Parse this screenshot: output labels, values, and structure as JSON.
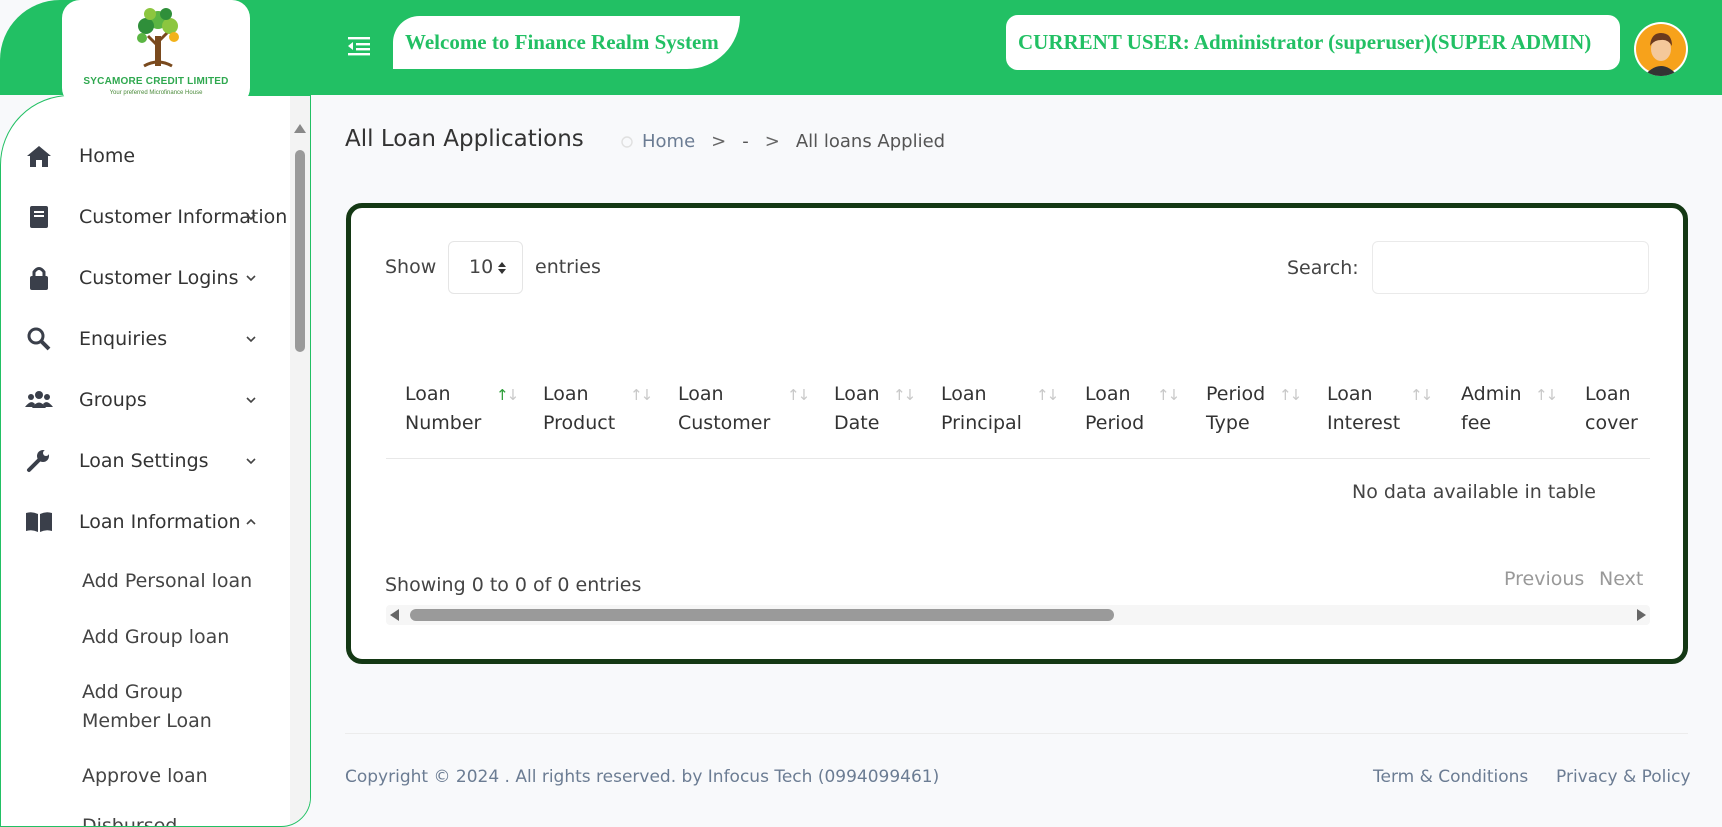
{
  "colors": {
    "brand_green": "#22c064",
    "card_border": "#143814",
    "muted_text": "#6b7c93"
  },
  "header": {
    "logo_title": "SYCAMORE CREDIT LIMITED",
    "logo_tagline": "Your preferred Microfinance House",
    "welcome": "Welcome to Finance Realm System",
    "current_user": "CURRENT USER: Administrator (superuser)(SUPER ADMIN)",
    "menu_icon": "menu-toggle-icon",
    "avatar_icon": "user-avatar"
  },
  "sidebar": {
    "items": [
      {
        "label": "Home",
        "icon": "home-icon"
      },
      {
        "label": "Customer Information",
        "icon": "book-icon",
        "expanded": false
      },
      {
        "label": "Customer Logins",
        "icon": "lock-icon",
        "expanded": false
      },
      {
        "label": "Enquiries",
        "icon": "search-icon",
        "expanded": false
      },
      {
        "label": "Groups",
        "icon": "users-icon",
        "expanded": false
      },
      {
        "label": "Loan Settings",
        "icon": "wrench-icon",
        "expanded": false
      },
      {
        "label": "Loan Information",
        "icon": "open-book-icon",
        "expanded": true
      }
    ],
    "sub_items": [
      "Add Personal loan",
      "Add Group loan",
      "Add Group\nMember Loan",
      "Approve loan",
      "Disbursed"
    ]
  },
  "page": {
    "title": "All Loan Applications",
    "breadcrumb": {
      "home": "Home",
      "sep": ">",
      "middle": "-",
      "current": "All loans Applied"
    }
  },
  "table": {
    "show_label": "Show",
    "page_size": "10",
    "entries_label": "entries",
    "search_label": "Search:",
    "search_value": "",
    "columns": [
      {
        "line1": "Loan",
        "line2": "Number",
        "sort": "asc"
      },
      {
        "line1": "Loan",
        "line2": "Product",
        "sort": "none"
      },
      {
        "line1": "Loan",
        "line2": "Customer",
        "sort": "none"
      },
      {
        "line1": "Loan",
        "line2": "Date",
        "sort": "none"
      },
      {
        "line1": "Loan",
        "line2": "Principal",
        "sort": "none"
      },
      {
        "line1": "Loan",
        "line2": "Period",
        "sort": "none"
      },
      {
        "line1": "Period",
        "line2": "Type",
        "sort": "none"
      },
      {
        "line1": "Loan",
        "line2": "Interest",
        "sort": "none"
      },
      {
        "line1": "Admin",
        "line2": "fee",
        "sort": "none"
      },
      {
        "line1": "Loan",
        "line2": "cover",
        "sort": "none"
      }
    ],
    "empty_message": "No data available in table",
    "info": "Showing 0 to 0 of 0 entries",
    "prev_label": "Previous",
    "next_label": "Next"
  },
  "footer": {
    "copyright": "Copyright © 2024 . All rights reserved. by Infocus Tech (0994099461)",
    "terms": "Term & Conditions",
    "privacy": "Privacy & Policy"
  }
}
